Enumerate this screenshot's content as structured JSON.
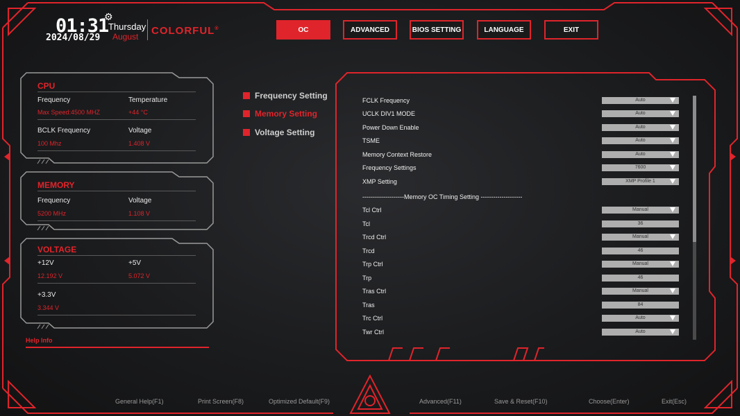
{
  "header": {
    "time": "01:31",
    "day": "Thursday",
    "month": "August",
    "date": "2024/08/29",
    "brand": "COLORFUL",
    "brand_mark": "®"
  },
  "nav": [
    {
      "label": "OC",
      "active": true
    },
    {
      "label": "ADVANCED",
      "active": false
    },
    {
      "label": "BIOS SETTING",
      "active": false
    },
    {
      "label": "LANGUAGE",
      "active": false
    },
    {
      "label": "EXIT",
      "active": false
    }
  ],
  "cpu": {
    "title": "CPU",
    "frequency_label": "Frequency",
    "frequency_value": "Max Speed:4500 MHZ",
    "temperature_label": "Temperature",
    "temperature_value": "+44 °C",
    "bclk_label": "BCLK Frequency",
    "bclk_value": "100 Mhz",
    "voltage_label": "Voltage",
    "voltage_value": "1.408 V"
  },
  "memory": {
    "title": "MEMORY",
    "frequency_label": "Frequency",
    "frequency_value": "5200 MHz",
    "voltage_label": "Voltage",
    "voltage_value": "1.108 V"
  },
  "voltage": {
    "title": "VOLTAGE",
    "v12_label": "+12V",
    "v12_value": "12.192 V",
    "v5_label": "+5V",
    "v5_value": "5.072 V",
    "v33_label": "+3.3V",
    "v33_value": "3.344 V"
  },
  "help": {
    "label": "Help Info"
  },
  "menu": [
    {
      "label": "Frequency Setting",
      "active": false
    },
    {
      "label": "Memory Setting",
      "active": true
    },
    {
      "label": "Voltage Setting",
      "active": false
    }
  ],
  "settings": [
    {
      "name": "FCLK Frequency",
      "value": "Auto",
      "dropdown": true
    },
    {
      "name": "UCLK DIV1 MODE",
      "value": "Auto",
      "dropdown": true
    },
    {
      "name": "Power Down Enable",
      "value": "Auto",
      "dropdown": true
    },
    {
      "name": "TSME",
      "value": "Auto",
      "dropdown": true
    },
    {
      "name": "Memory Context Restore",
      "value": "Auto",
      "dropdown": true
    },
    {
      "name": "Frequency Settings",
      "value": "7600",
      "dropdown": true
    },
    {
      "name": "XMP Setting",
      "value": "XMP Profile 1",
      "dropdown": true
    }
  ],
  "divider": "--------------------Memory OC Timing Setting --------------------",
  "timings": [
    {
      "name": "Tcl Ctrl",
      "value": "Manual",
      "dropdown": true
    },
    {
      "name": "Tcl",
      "value": "36",
      "dropdown": false
    },
    {
      "name": "Trcd Ctrl",
      "value": "Manual",
      "dropdown": true
    },
    {
      "name": "Trcd",
      "value": "46",
      "dropdown": false
    },
    {
      "name": "Trp Ctrl",
      "value": "Manual",
      "dropdown": true
    },
    {
      "name": "Trp",
      "value": "46",
      "dropdown": false
    },
    {
      "name": "Tras Ctrl",
      "value": "Manual",
      "dropdown": true
    },
    {
      "name": "Tras",
      "value": "84",
      "dropdown": false
    },
    {
      "name": "Trc Ctrl",
      "value": "Auto",
      "dropdown": true
    },
    {
      "name": "Twr Ctrl",
      "value": "Auto",
      "dropdown": true
    }
  ],
  "scroll_position": 0.6,
  "footer": [
    {
      "label": "General Help(F1)"
    },
    {
      "label": "Print Screen(F8)"
    },
    {
      "label": "Optimized Default(F9)"
    },
    {
      "label": "Advanced(F11)"
    },
    {
      "label": "Save & Reset(F10)"
    },
    {
      "label": "Choose(Enter)"
    },
    {
      "label": "Exit(Esc)"
    }
  ],
  "colors": {
    "accent": "#e0242b",
    "control": "#aeaeae",
    "background": "#1b1c1e"
  },
  "icons": [
    "gear-icon",
    "colorful-logo-icon",
    "dropdown-arrow-icon"
  ]
}
